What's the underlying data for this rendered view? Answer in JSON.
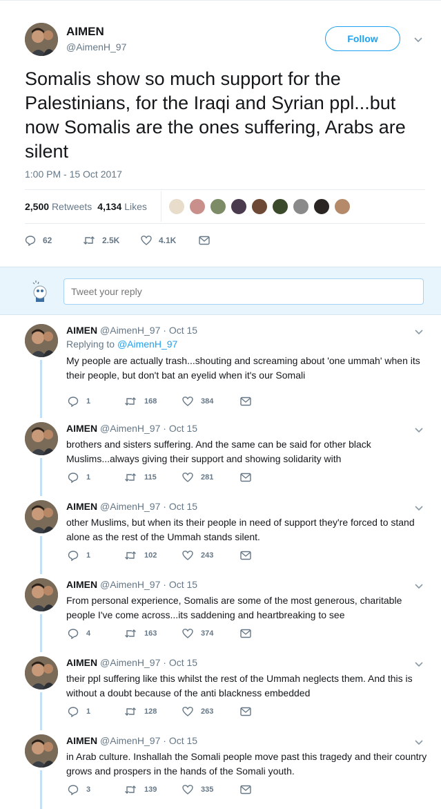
{
  "main_tweet": {
    "name": "AIMEN",
    "handle": "@AimenH_97",
    "follow_label": "Follow",
    "text": "Somalis show so much support for the Palestinians, for the Iraqi and Syrian ppl...but now Somalis are the ones suffering, Arabs are silent",
    "timestamp": "1:00 PM - 15 Oct 2017",
    "retweets_count": "2,500",
    "retweets_label": "Retweets",
    "likes_count": "4,134",
    "likes_label": "Likes",
    "actions": {
      "replies": "62",
      "retweets": "2.5K",
      "likes": "4.1K"
    }
  },
  "reply_box": {
    "placeholder": "Tweet your reply"
  },
  "replies": [
    {
      "name": "AIMEN",
      "meta": "@AimenH_97 · Oct 15",
      "replying_prefix": "Replying to ",
      "replying_to": "@AimenH_97",
      "text": "My people are actually trash...shouting and screaming about 'one ummah' when its their people, but don't bat an eyelid when it's our Somali",
      "replies": "1",
      "retweets": "168",
      "likes": "384"
    },
    {
      "name": "AIMEN",
      "meta": "@AimenH_97 · Oct 15",
      "text": "brothers and sisters suffering. And the same can be said for other black Muslims...always giving their support and showing solidarity with",
      "replies": "1",
      "retweets": "115",
      "likes": "281"
    },
    {
      "name": "AIMEN",
      "meta": "@AimenH_97 · Oct 15",
      "text": "other Muslims, but when its their people in need of support they're forced to stand alone as the rest of the Ummah stands silent.",
      "replies": "1",
      "retweets": "102",
      "likes": "243"
    },
    {
      "name": "AIMEN",
      "meta": "@AimenH_97 · Oct 15",
      "text": "From personal experience, Somalis are some of the most generous, charitable people I've come across...its saddening and heartbreaking to see",
      "replies": "4",
      "retweets": "163",
      "likes": "374"
    },
    {
      "name": "AIMEN",
      "meta": "@AimenH_97 · Oct 15",
      "text": "their ppl suffering like this whilst the rest of the Ummah neglects them. And this is without a doubt because of the anti blackness embedded",
      "replies": "1",
      "retweets": "128",
      "likes": "263"
    },
    {
      "name": "AIMEN",
      "meta": "@AimenH_97 · Oct 15",
      "text": "in Arab culture. Inshallah the Somali people move past this tragedy and their country grows and prospers in the hands of the Somali youth.",
      "replies": "3",
      "retweets": "139",
      "likes": "335"
    }
  ],
  "icons": {
    "reply": "reply-icon",
    "retweet": "retweet-icon",
    "like": "heart-icon",
    "dm": "envelope-icon",
    "caret": "chevron-down-icon"
  },
  "colors": {
    "accent": "#1da1f2",
    "muted": "#657786",
    "text": "#14171a",
    "thread": "#c2dff5",
    "reply_bg": "#e8f5fd"
  }
}
